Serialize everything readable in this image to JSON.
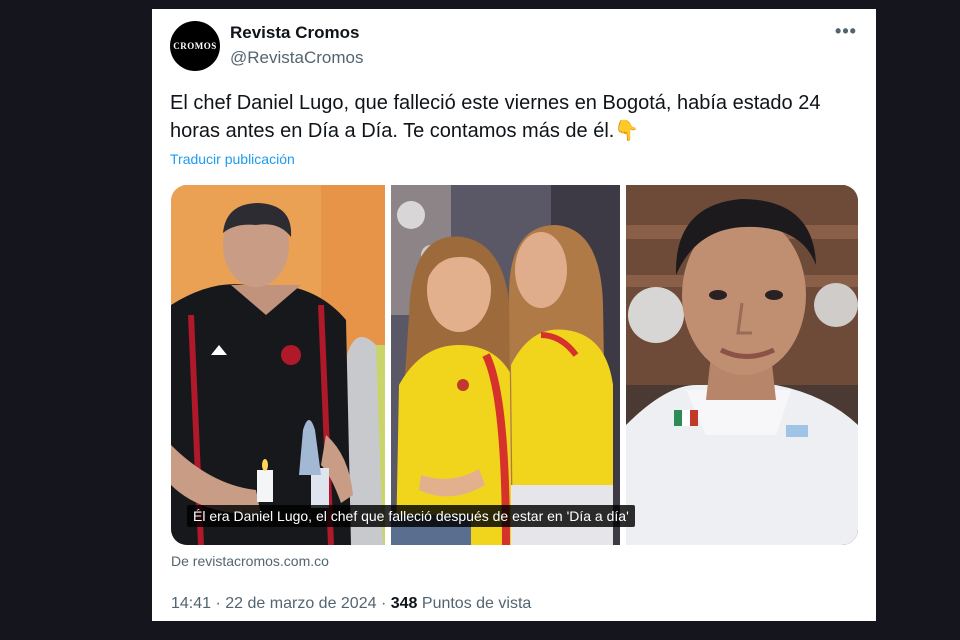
{
  "tweet": {
    "author": {
      "name": "Revista Cromos",
      "handle": "@RevistaCromos",
      "avatar_text": "CROMOS"
    },
    "more_label": "•••",
    "text": "El chef Daniel Lugo, que falleció este viernes en Bogotá, había estado 24 horas antes en Día a Día. Te contamos más de él.",
    "emoji": "👇",
    "translate_label": "Traducir publicación",
    "media": {
      "caption": "Él era Daniel Lugo, el chef que falleció después de estar en 'Día a día'"
    },
    "link_source": "De revistacromos.com.co",
    "meta": {
      "time": "14:41",
      "separator1": "·",
      "date": "22 de marzo de 2024",
      "separator2": "·",
      "views_count": "348",
      "views_label": "Puntos de vista"
    }
  },
  "colors": {
    "background": "#15161d",
    "card": "#ffffff",
    "link": "#1d9bf0",
    "secondary_text": "#536471",
    "primary_text": "#0f1419"
  }
}
